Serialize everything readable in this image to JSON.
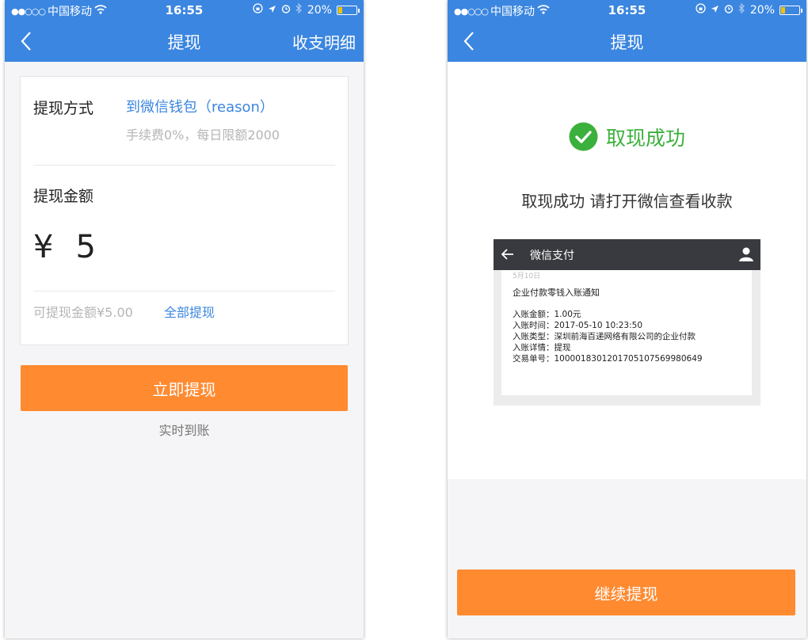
{
  "status_bar": {
    "signal_dots": "●●○○○",
    "carrier": "中国移动",
    "time": "16:55",
    "battery": "20%",
    "battery_level": 0.2
  },
  "left": {
    "nav_title": "提现",
    "nav_right": "收支明细",
    "method_label": "提现方式",
    "method_value": "到微信钱包（reason）",
    "method_note": "手续费0%，每日限额2000",
    "amount_label": "提现金额",
    "currency": "¥",
    "amount": "5",
    "available": "可提现金额¥5.00",
    "withdraw_all": "全部提现",
    "submit": "立即提现",
    "realtime": "实时到账"
  },
  "right": {
    "nav_title": "提现",
    "success_title": "取现成功",
    "success_message": "取现成功 请打开微信查看收款",
    "wechat": {
      "title": "微信支付",
      "date": "5月10日",
      "notice": "企业付款零钱入账通知",
      "lines": [
        "入账金额：1.00元",
        "入账时间：2017-05-10 10:23:50",
        "入账类型：深圳前海百递网络有限公司的企业付款",
        "入账详情：提现",
        "交易单号：1000018301201705107569980649"
      ]
    },
    "continue": "继续提现"
  },
  "colors": {
    "header": "#3b86e0",
    "accent_button": "#ff8a30",
    "link": "#3b86e0",
    "success": "#3cb03c"
  }
}
